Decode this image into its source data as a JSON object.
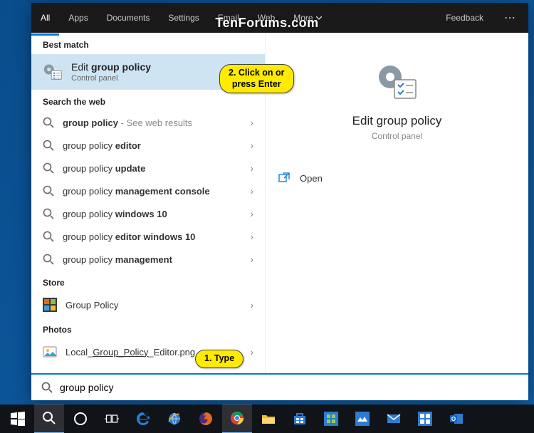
{
  "watermark": "TenForums.com",
  "tabs": {
    "items": [
      "All",
      "Apps",
      "Documents",
      "Settings",
      "Email",
      "Web",
      "More"
    ],
    "feedback": "Feedback"
  },
  "sections": {
    "best_match": "Best match",
    "search_web": "Search the web",
    "store": "Store",
    "photos": "Photos"
  },
  "best": {
    "title_pre": "Edit ",
    "title_bold": "group policy",
    "sub": "Control panel"
  },
  "web": [
    {
      "pre": "",
      "bold": "group policy",
      "post": "",
      "note": " - See web results"
    },
    {
      "pre": "group policy ",
      "bold": "editor",
      "post": ""
    },
    {
      "pre": "group policy ",
      "bold": "update",
      "post": ""
    },
    {
      "pre": "group policy ",
      "bold": "management console",
      "post": ""
    },
    {
      "pre": "group policy ",
      "bold": "windows 10",
      "post": ""
    },
    {
      "pre": "group policy ",
      "bold": "editor windows 10",
      "post": ""
    },
    {
      "pre": "group policy ",
      "bold": "management",
      "post": ""
    }
  ],
  "store": {
    "label": "Group Policy"
  },
  "photos": {
    "pre": "Local_",
    "u": "Group_Policy",
    "post": "_Editor.png"
  },
  "preview": {
    "title": "Edit group policy",
    "sub": "Control panel",
    "open": "Open"
  },
  "search": {
    "value": "group policy"
  },
  "callouts": {
    "type": "1. Type",
    "click": "2. Click on or\npress Enter"
  }
}
